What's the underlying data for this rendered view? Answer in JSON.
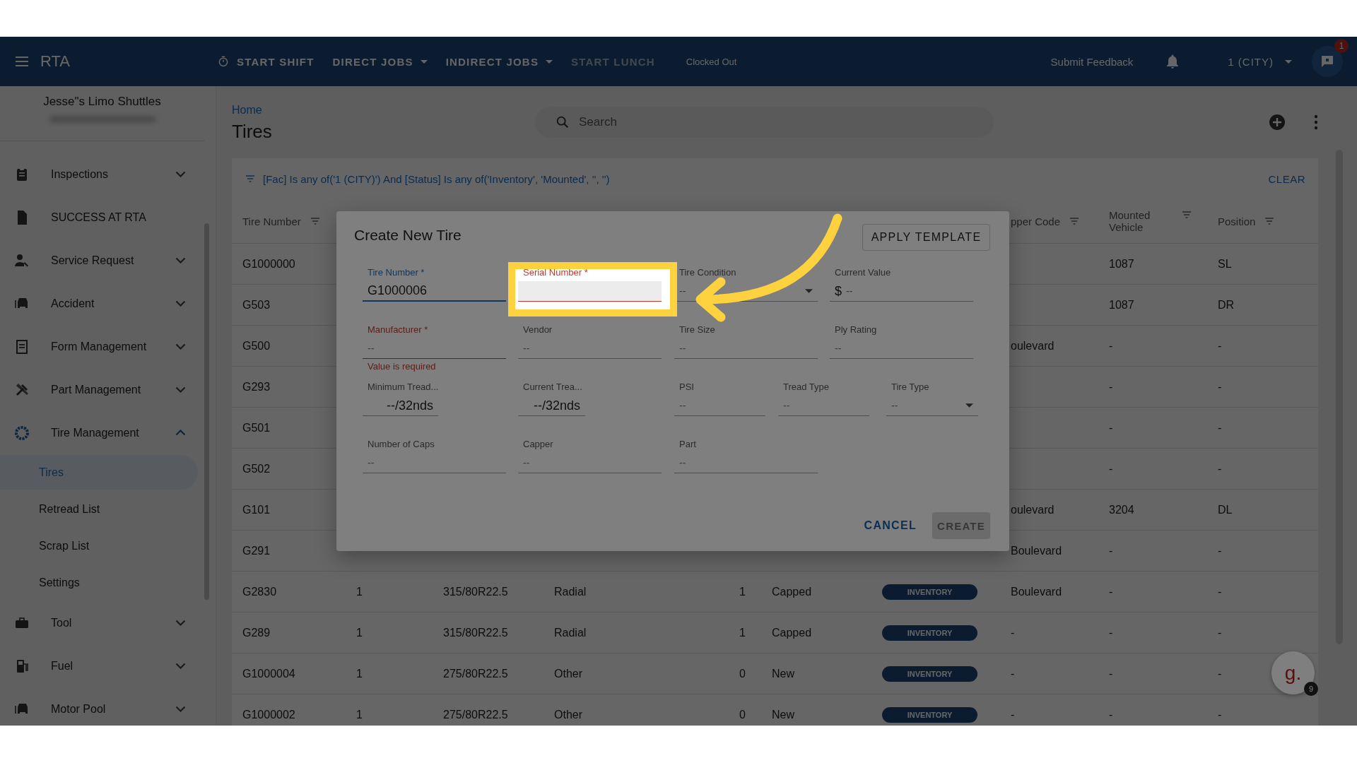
{
  "app_bar": {
    "title": "RTA",
    "actions": [
      {
        "label": "START SHIFT",
        "kind": "timer",
        "disabled": false
      },
      {
        "label": "DIRECT JOBS",
        "kind": "menu",
        "disabled": false
      },
      {
        "label": "INDIRECT JOBS",
        "kind": "menu",
        "disabled": false
      },
      {
        "label": "START LUNCH",
        "kind": "plain",
        "disabled": true
      }
    ],
    "status": "Clocked Out",
    "feedback": "Submit Feedback",
    "facility": "1 (CITY)",
    "help_badge": "1"
  },
  "sidebar": {
    "company": "Jesse\"s Limo Shuttles",
    "items": [
      {
        "label": "Inspections",
        "expandable": true,
        "expanded": false
      },
      {
        "label": "SUCCESS AT RTA",
        "expandable": false
      },
      {
        "label": "Service Request",
        "expandable": true,
        "expanded": false
      },
      {
        "label": "Accident",
        "expandable": true,
        "expanded": false
      },
      {
        "label": "Form Management",
        "expandable": true,
        "expanded": false
      },
      {
        "label": "Part Management",
        "expandable": true,
        "expanded": false
      },
      {
        "label": "Tire Management",
        "expandable": true,
        "expanded": true,
        "children": [
          {
            "label": "Tires",
            "selected": true
          },
          {
            "label": "Retread List",
            "selected": false
          },
          {
            "label": "Scrap List",
            "selected": false
          },
          {
            "label": "Settings",
            "selected": false
          }
        ]
      },
      {
        "label": "Tool",
        "expandable": true,
        "expanded": false
      },
      {
        "label": "Fuel",
        "expandable": true,
        "expanded": false
      },
      {
        "label": "Motor Pool",
        "expandable": true,
        "expanded": false
      }
    ]
  },
  "page": {
    "breadcrumb": "Home",
    "title": "Tires",
    "search_placeholder": "Search"
  },
  "table": {
    "filter": "[Fac] Is any of('1 (CITY)') And [Status] Is any of('Inventory', 'Mounted', '', '')",
    "clear": "CLEAR",
    "columns": {
      "tire_number": "Tire Number",
      "capper_code": "pper Code",
      "mounted_vehicle": "Mounted Vehicle",
      "position": "Position"
    },
    "rows": [
      {
        "tire_number": "G1000000",
        "mounted_vehicle": "1087",
        "position": "SL"
      },
      {
        "tire_number": "G503",
        "mounted_vehicle": "1087",
        "position": "DR"
      },
      {
        "tire_number": "G500",
        "capper_code": "oulevard",
        "mounted_vehicle": "-",
        "position": "-"
      },
      {
        "tire_number": "G293",
        "mounted_vehicle": "-",
        "position": "-"
      },
      {
        "tire_number": "G501",
        "mounted_vehicle": "-",
        "position": "-"
      },
      {
        "tire_number": "G502",
        "mounted_vehicle": "-",
        "position": "-"
      },
      {
        "tire_number": "G101",
        "capper_code": "oulevard",
        "mounted_vehicle": "3204",
        "position": "DL"
      },
      {
        "tire_number": "G291",
        "capper_code": "Boulevard",
        "mounted_vehicle": "-",
        "position": "-"
      },
      {
        "tire_number": "G2830",
        "column_2": "1",
        "column_3": "315/80R22.5",
        "column_4": "Radial",
        "column_5": "1",
        "column_6": "Capped",
        "status": "INVENTORY",
        "capper_code": "Boulevard",
        "mounted_vehicle": "-",
        "position": "-"
      },
      {
        "tire_number": "G289",
        "column_2": "1",
        "column_3": "315/80R22.5",
        "column_4": "Radial",
        "column_5": "1",
        "column_6": "Capped",
        "status": "INVENTORY",
        "capper_code": "-",
        "mounted_vehicle": "-",
        "position": "-"
      },
      {
        "tire_number": "G1000004",
        "column_2": "1",
        "column_3": "275/80R22.5",
        "column_4": "Other",
        "column_5": "0",
        "column_6": "New",
        "status": "INVENTORY",
        "capper_code": "-",
        "mounted_vehicle": "-",
        "position": "-"
      },
      {
        "tire_number": "G1000002",
        "column_2": "1",
        "column_3": "275/80R22.5",
        "column_4": "Other",
        "column_5": "0",
        "column_6": "New",
        "status": "INVENTORY",
        "capper_code": "-",
        "mounted_vehicle": "-",
        "position": "-"
      }
    ]
  },
  "dialog": {
    "title": "Create New Tire",
    "template_button": "APPLY TEMPLATE",
    "rows": [
      [
        {
          "label": "Tire Number *",
          "value": "G1000006",
          "kind": "text",
          "focused": true,
          "invalid": false
        },
        {
          "label": "Serial Number *",
          "kind": "text",
          "focused": true,
          "invalid": true
        },
        {
          "label": "Tire Condition",
          "placeholder": "--",
          "kind": "select",
          "focused": false,
          "invalid": false
        },
        {
          "label": "Current Value",
          "prefix": "$",
          "placeholder": "--",
          "kind": "text",
          "focused": false,
          "invalid": false
        }
      ],
      [
        {
          "label": "Manufacturer *",
          "placeholder": "--",
          "kind": "text",
          "focused": false,
          "invalid": true,
          "helper": "Value is required"
        },
        {
          "label": "Vendor",
          "placeholder": "--",
          "kind": "text",
          "focused": false,
          "invalid": false
        },
        {
          "label": "Tire Size",
          "placeholder": "--",
          "kind": "text",
          "focused": false,
          "invalid": false
        },
        {
          "label": "Ply Rating",
          "placeholder": "--",
          "kind": "text",
          "focused": false,
          "invalid": false
        }
      ],
      [
        {
          "label": "Minimum Tread...",
          "value": "--/32nds",
          "kind": "measure",
          "focused": false,
          "invalid": false
        },
        {
          "label": "Current Trea...",
          "value": "--/32nds",
          "kind": "measure",
          "focused": false,
          "invalid": false
        },
        {
          "label": "PSI",
          "placeholder": "--",
          "kind": "text",
          "focused": false,
          "invalid": false
        },
        {
          "label": "Tread Type",
          "placeholder": "--",
          "kind": "text",
          "focused": false,
          "invalid": false
        },
        {
          "label": "Tire Type",
          "placeholder": "--",
          "kind": "select",
          "focused": false,
          "invalid": false
        }
      ],
      [
        {
          "label": "Number of Caps",
          "placeholder": "--",
          "kind": "text",
          "focused": false,
          "invalid": false
        },
        {
          "label": "Capper",
          "placeholder": "--",
          "kind": "text",
          "focused": false,
          "invalid": false
        },
        {
          "label": "Part",
          "placeholder": "--",
          "kind": "text",
          "focused": false,
          "invalid": false
        }
      ]
    ],
    "cancel": "CANCEL",
    "create": "CREATE",
    "create_disabled": true
  },
  "assistant": {
    "label": "g.",
    "badge": "9"
  }
}
